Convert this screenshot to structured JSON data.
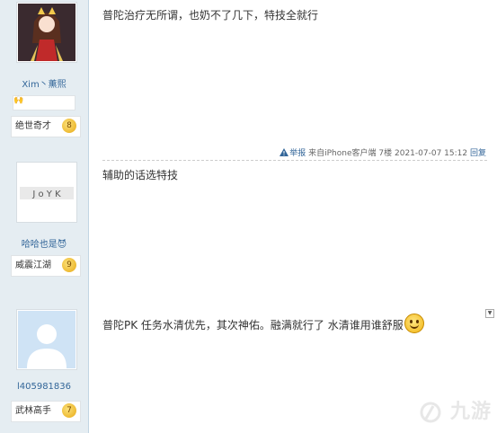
{
  "users": [
    {
      "name": "Xim丶薰熙",
      "rank": "绝世奇才",
      "level": "8",
      "badge": "🙌"
    },
    {
      "name": "哈哈也是😈",
      "rank": "威震江湖",
      "level": "9"
    },
    {
      "name": "l405981836",
      "rank": "武林高手",
      "level": "7"
    }
  ],
  "posts": [
    {
      "text": "普陀治疗无所谓，也奶不了几下，特技全就行"
    },
    {
      "text": "辅助的话选特技",
      "meta": {
        "report": "举报",
        "source": "来自iPhone客户端",
        "floor": "7楼",
        "time": "2021-07-07 15:12",
        "reply": "回复"
      }
    },
    {
      "text": "普陀PK 任务水清优先，其次神佑。融满就行了 水清谁用谁舒服"
    }
  ],
  "avatar2_text": "J o Y K",
  "watermark": "九游",
  "colors": {
    "sidebar": "#e5edf2",
    "link": "#336699"
  }
}
